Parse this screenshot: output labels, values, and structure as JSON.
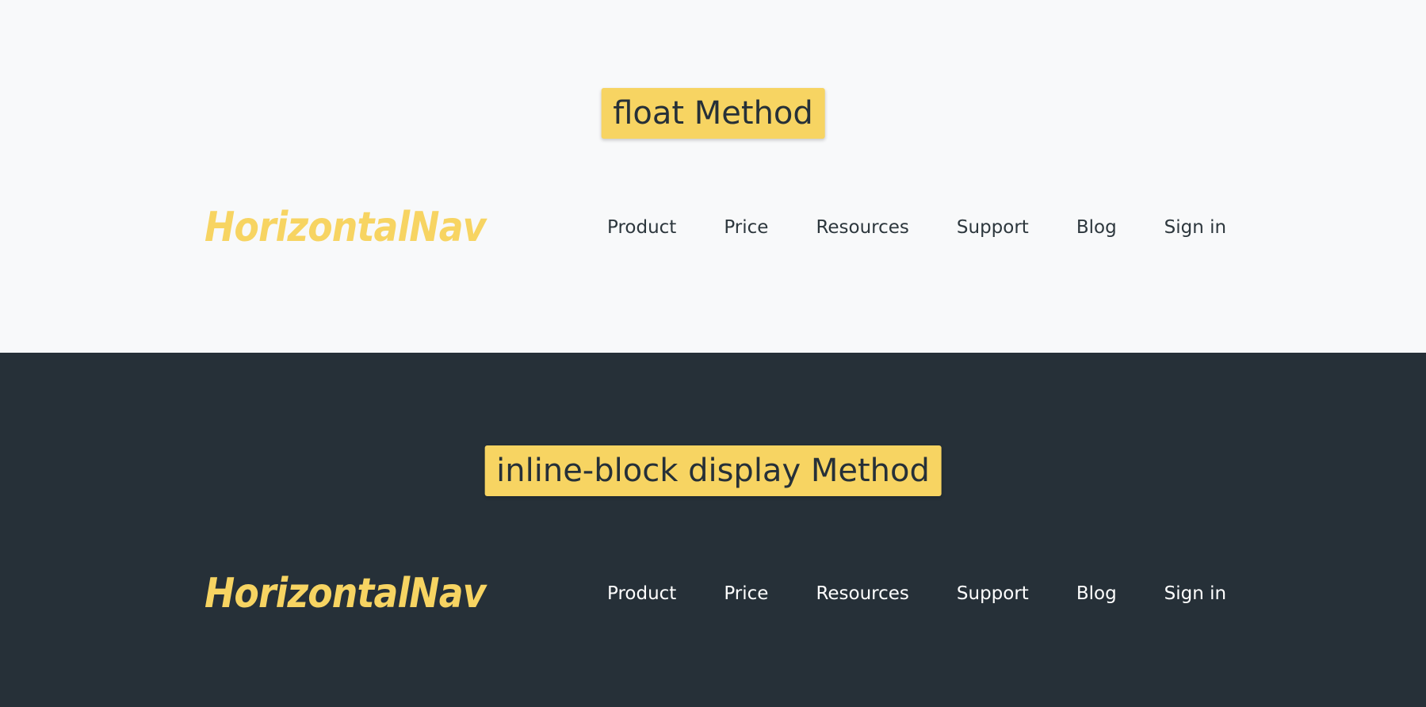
{
  "float_section": {
    "heading": "float Method",
    "logo": "HorizontalNav",
    "nav_items": [
      "Product",
      "Price",
      "Resources",
      "Support",
      "Blog",
      "Sign in"
    ]
  },
  "inline_section": {
    "heading": "inline-block display Method",
    "logo": "HorizontalNav",
    "nav_items": [
      "Product",
      "Price",
      "Resources",
      "Support",
      "Blog",
      "Sign in"
    ]
  },
  "colors": {
    "accent": "#f7d462",
    "dark_background": "#263038",
    "light_background": "#f8f9fa",
    "text_dark": "#2d373d",
    "text_light": "#ffffff"
  }
}
